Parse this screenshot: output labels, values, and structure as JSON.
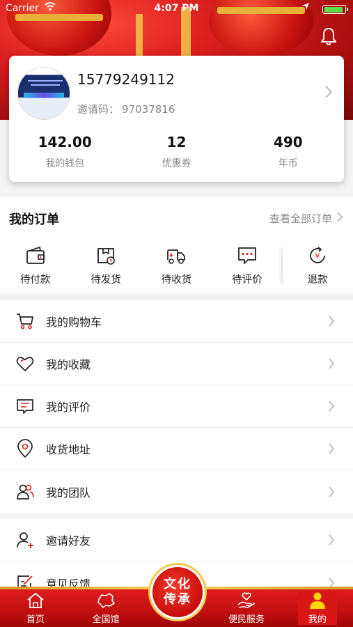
{
  "status_bar": {
    "carrier": "Carrier",
    "time": "4:07 PM"
  },
  "profile": {
    "phone": "15779249112",
    "invite_label": "邀请码：",
    "invite_code": "97037816"
  },
  "stats": [
    {
      "value": "142.00",
      "label": "我的钱包"
    },
    {
      "value": "12",
      "label": "优惠券"
    },
    {
      "value": "490",
      "label": "年币"
    }
  ],
  "orders": {
    "title": "我的订单",
    "view_all": "查看全部订单",
    "items": [
      {
        "label": "待付款",
        "icon": "wallet-icon"
      },
      {
        "label": "待发货",
        "icon": "package-icon"
      },
      {
        "label": "待收货",
        "icon": "truck-icon"
      },
      {
        "label": "待评价",
        "icon": "comment-icon"
      },
      {
        "label": "退款",
        "icon": "refund-icon"
      }
    ]
  },
  "menu_group1": [
    {
      "label": "我的购物车",
      "icon": "cart-icon"
    },
    {
      "label": "我的收藏",
      "icon": "heart-icon"
    },
    {
      "label": "我的评价",
      "icon": "review-icon"
    },
    {
      "label": "收货地址",
      "icon": "location-icon"
    },
    {
      "label": "我的团队",
      "icon": "team-icon"
    }
  ],
  "menu_group2": [
    {
      "label": "邀请好友",
      "icon": "add-user-icon"
    },
    {
      "label": "意见反馈",
      "icon": "feedback-icon"
    }
  ],
  "tabbar": {
    "tabs": [
      {
        "label": "首页",
        "icon": "home-icon"
      },
      {
        "label": "全国馆",
        "icon": "map-icon"
      },
      {
        "label": "便民服务",
        "icon": "hand-heart-icon"
      },
      {
        "label": "我的",
        "icon": "user-icon"
      }
    ],
    "center_logo_line1": "文化",
    "center_logo_line2": "传承"
  },
  "colors": {
    "brand_red": "#d81d1d",
    "gold": "#f2c84d",
    "active_tab_icon": "#ffd400"
  }
}
